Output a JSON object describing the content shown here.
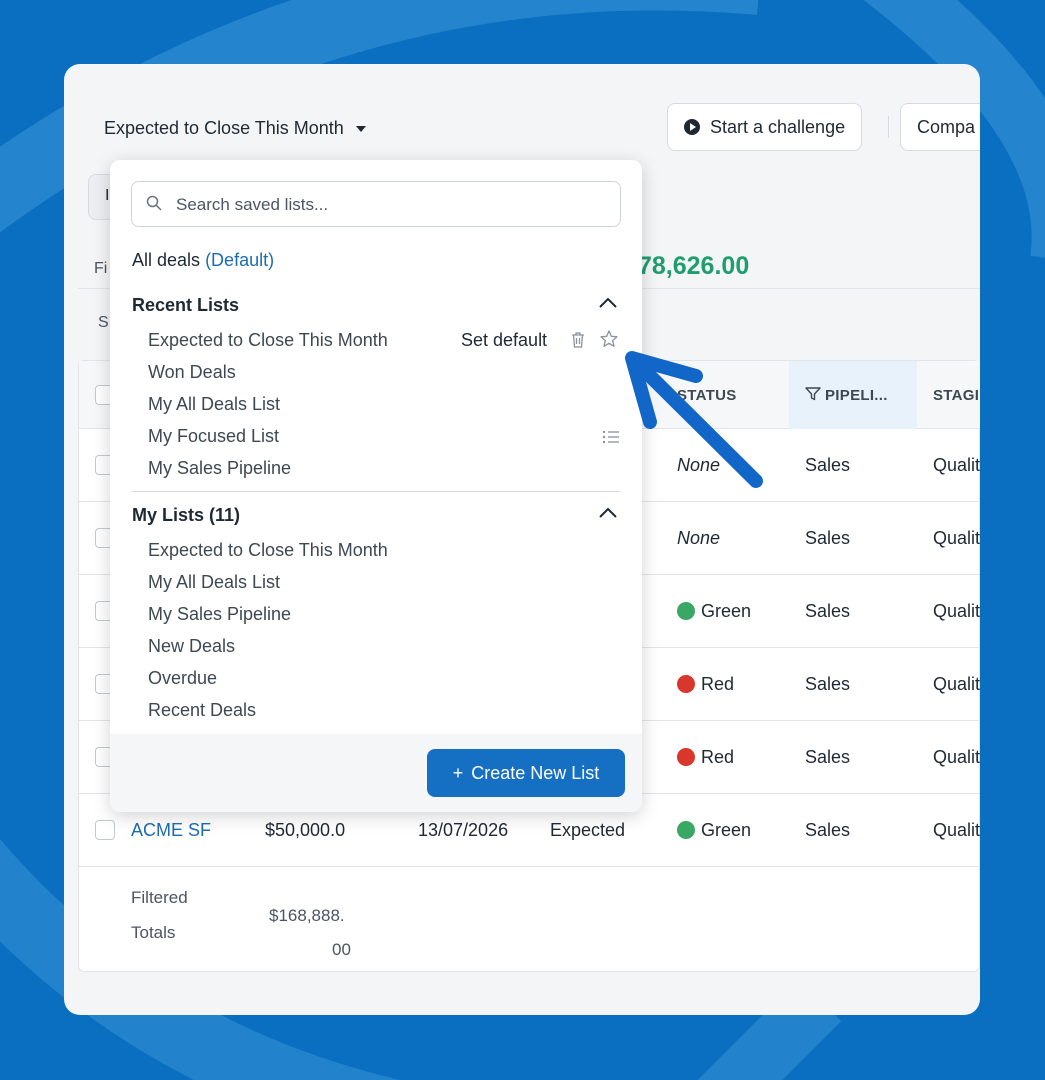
{
  "colors": {
    "background": "#0a6fc0",
    "accent": "#1570c4",
    "link": "#1b6cb5",
    "total_green": "#1f9d6d",
    "status_green": "#3aa865",
    "status_red": "#d9372b",
    "arrow": "#1166c8"
  },
  "header": {
    "title": "Expected to Close This Month",
    "start_challenge": "Start a challenge",
    "compare": "Compa"
  },
  "ghost": {
    "tab_letter": "I",
    "fi": "Fi",
    "s": "S",
    "total": "78,626.00"
  },
  "table": {
    "columns": [
      "STATUS",
      "PIPELI...",
      "STAGI"
    ],
    "rows": [
      {
        "status": "None",
        "status_color": "",
        "pipeline": "Sales",
        "stage": "Qualit"
      },
      {
        "status": "None",
        "status_color": "",
        "pipeline": "Sales",
        "stage": "Qualit"
      },
      {
        "status": "Green",
        "status_color": "green",
        "pipeline": "Sales",
        "stage": "Qualit"
      },
      {
        "status": "Red",
        "status_color": "red",
        "pipeline": "Sales",
        "stage": "Qualit"
      },
      {
        "status": "Red",
        "status_color": "red",
        "pipeline": "Sales",
        "stage": "Qualit"
      }
    ],
    "last_row": {
      "name": "ACME SF",
      "amount": "$50,000.0",
      "date": "13/07/2026",
      "forecast": "Expected",
      "status": "Green",
      "pipeline": "Sales",
      "stage": "Qualit"
    },
    "footer": {
      "label_1": "Filtered",
      "label_2": "Totals",
      "value_1": "$168,888.",
      "value_2": "00"
    }
  },
  "dropdown": {
    "search_placeholder": "Search saved lists...",
    "all_deals": "All deals",
    "default_tag": "(Default)",
    "recent_heading": "Recent Lists",
    "recent": [
      "Expected to Close This Month",
      "Won Deals",
      "My All Deals List",
      "My Focused List",
      "My Sales Pipeline"
    ],
    "set_default": "Set default",
    "my_lists_heading": "My Lists (11)",
    "my_lists": [
      "Expected to Close This Month",
      "My All Deals List",
      "My Sales Pipeline",
      "New Deals",
      "Overdue",
      "Recent Deals"
    ],
    "create_button": "Create New List",
    "create_icon": "+"
  }
}
